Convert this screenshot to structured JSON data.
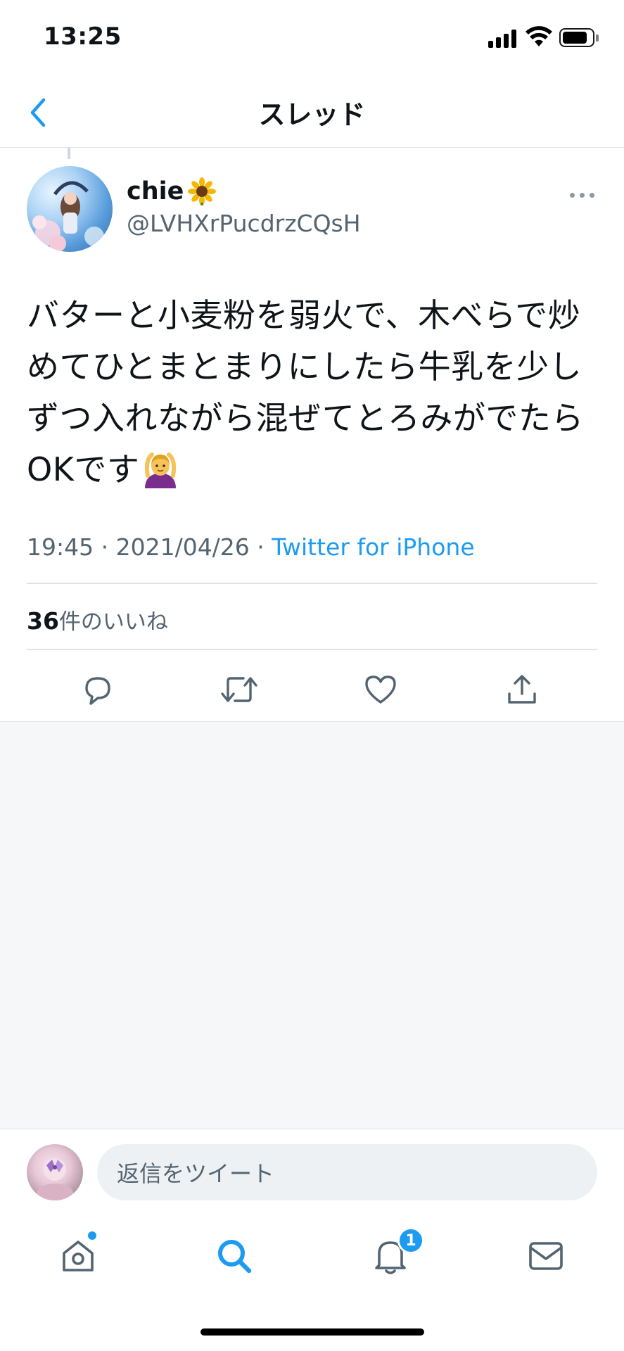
{
  "status_bar": {
    "time": "13:25"
  },
  "header": {
    "title": "スレッド"
  },
  "tweet": {
    "display_name": "chie",
    "handle": "@LVHXrPucdrzCQsH",
    "text": "バターと小麦粉を弱火で、木べらで炒めてひとまとまりにしたら牛乳を少しずつ入れながら混ぜてとろみがでたらOKです",
    "time": "19:45",
    "date": "2021/04/26",
    "separator": " · ",
    "source": "Twitter for iPhone",
    "likes_count": "36",
    "likes_label": "件のいいね"
  },
  "reply": {
    "placeholder": "返信をツイート"
  },
  "tabbar": {
    "notification_badge": "1"
  },
  "colors": {
    "accent": "#1d9bf0",
    "muted": "#536471",
    "divider": "#dfe3e7",
    "empty_bg": "#f5f7f9"
  },
  "icons": [
    "back-chevron-icon",
    "sunflower-emoji",
    "more-icon",
    "gesture-ok-emoji",
    "reply-icon",
    "retweet-icon",
    "like-icon",
    "share-icon",
    "home-icon",
    "search-icon",
    "notifications-icon",
    "messages-icon"
  ]
}
